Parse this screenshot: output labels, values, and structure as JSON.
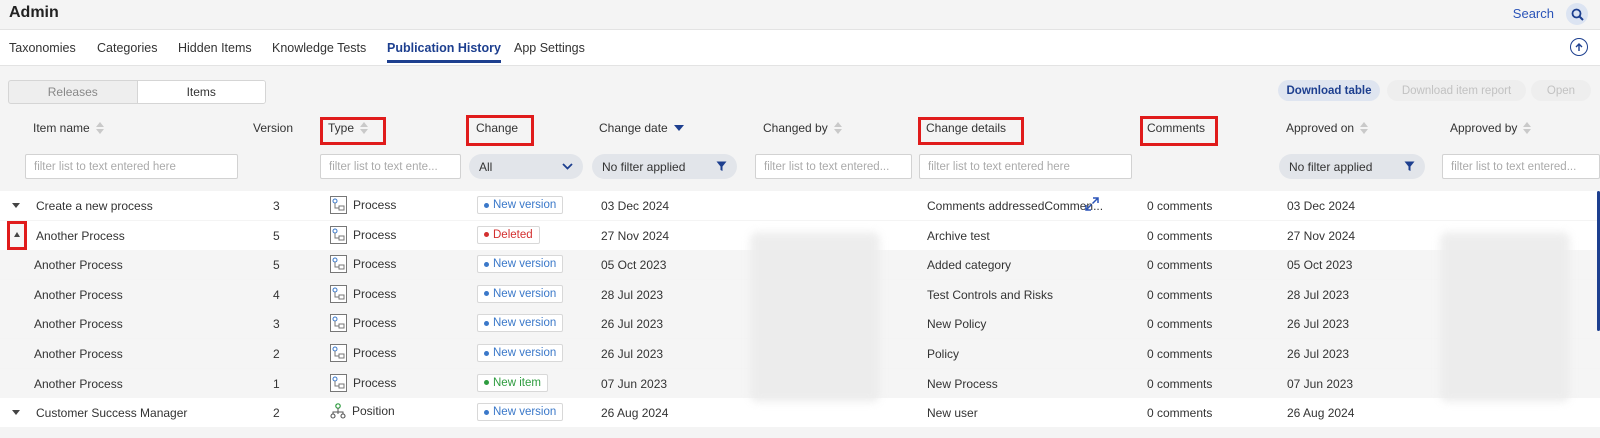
{
  "app": {
    "title": "Admin",
    "search_label": "Search"
  },
  "tabs": [
    {
      "label": "Taxonomies",
      "active": false
    },
    {
      "label": "Categories",
      "active": false
    },
    {
      "label": "Hidden Items",
      "active": false
    },
    {
      "label": "Knowledge Tests",
      "active": false
    },
    {
      "label": "Publication History",
      "active": true
    },
    {
      "label": "App Settings",
      "active": false
    }
  ],
  "view_toggle": {
    "releases": "Releases",
    "items": "Items",
    "selected": "Items"
  },
  "actions": {
    "download_table": "Download table",
    "download_item_report": "Download item report",
    "open": "Open"
  },
  "columns": {
    "item_name": "Item name",
    "version": "Version",
    "type": "Type",
    "change": "Change",
    "change_date": "Change date",
    "changed_by": "Changed by",
    "change_details": "Change details",
    "comments": "Comments",
    "approved_on": "Approved on",
    "approved_by": "Approved by"
  },
  "filters": {
    "item_name_placeholder": "filter list to text entered here",
    "type_placeholder": "filter list to text ente...",
    "change_value": "All",
    "change_date_value": "No filter applied",
    "changed_by_placeholder": "filter list to text entered...",
    "change_details_placeholder": "filter list to text entered here",
    "approved_on_value": "No filter applied",
    "approved_by_placeholder": "filter list to text entered..."
  },
  "rows": [
    {
      "kind": "parent",
      "expanded": false,
      "name": "Create a new process",
      "version": "3",
      "type": "Process",
      "change": "New version",
      "change_color": "#3a78c9",
      "change_date": "03 Dec 2024",
      "details": "Comments addressedCommen...",
      "comments": "0 comments",
      "approved_on": "03 Dec 2024"
    },
    {
      "kind": "parent",
      "expanded": true,
      "name": "Another Process",
      "version": "5",
      "type": "Process",
      "change": "Deleted",
      "change_color": "#d32f2f",
      "change_date": "27 Nov 2024",
      "details": "Archive test",
      "comments": "0 comments",
      "approved_on": "27 Nov 2024"
    },
    {
      "kind": "child",
      "name": "Another Process",
      "version": "5",
      "type": "Process",
      "change": "New version",
      "change_color": "#3a78c9",
      "change_date": "05 Oct 2023",
      "details": "Added category",
      "comments": "0 comments",
      "approved_on": "05 Oct 2023"
    },
    {
      "kind": "child",
      "name": "Another Process",
      "version": "4",
      "type": "Process",
      "change": "New version",
      "change_color": "#3a78c9",
      "change_date": "28 Jul 2023",
      "details": "Test Controls and Risks",
      "comments": "0 comments",
      "approved_on": "28 Jul 2023"
    },
    {
      "kind": "child",
      "name": "Another Process",
      "version": "3",
      "type": "Process",
      "change": "New version",
      "change_color": "#3a78c9",
      "change_date": "26 Jul 2023",
      "details": "New Policy",
      "comments": "0 comments",
      "approved_on": "26 Jul 2023"
    },
    {
      "kind": "child",
      "name": "Another Process",
      "version": "2",
      "type": "Process",
      "change": "New version",
      "change_color": "#3a78c9",
      "change_date": "26 Jul 2023",
      "details": "Policy",
      "comments": "0 comments",
      "approved_on": "26 Jul 2023"
    },
    {
      "kind": "child",
      "name": "Another Process",
      "version": "1",
      "type": "Process",
      "change": "New item",
      "change_color": "#2e9c3f",
      "change_date": "07 Jun 2023",
      "details": "New Process",
      "comments": "0 comments",
      "approved_on": "07 Jun 2023"
    },
    {
      "kind": "parent",
      "expanded": false,
      "name": "Customer Success Manager",
      "version": "2",
      "type": "Position",
      "change": "New version",
      "change_color": "#3a78c9",
      "change_date": "26 Aug 2024",
      "details": "New user",
      "comments": "0 comments",
      "approved_on": "26 Aug 2024"
    }
  ],
  "colors": {
    "accent": "#1d3f8f",
    "highlight": "#e01b1b",
    "link": "#2b54b8"
  },
  "icons": {
    "search": "search-icon",
    "upload": "arrow-up-circle-icon",
    "expand": "expand-arrows-icon",
    "filter": "filter-funnel-icon"
  }
}
